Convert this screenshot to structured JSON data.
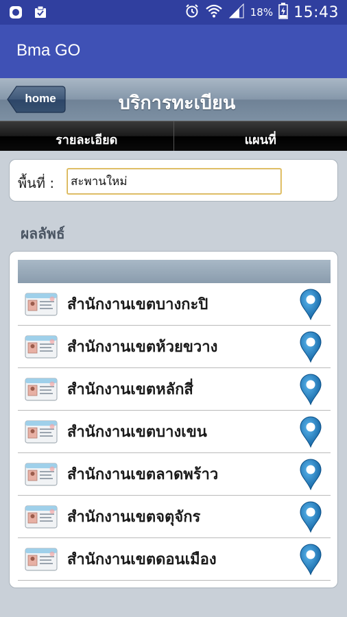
{
  "status_bar": {
    "battery_percent": "18%",
    "time": "15:43"
  },
  "app_bar": {
    "title": "Bma GO"
  },
  "page_header": {
    "home_label": "home",
    "title": "บริการทะเบียน"
  },
  "tabs": [
    {
      "label": "รายละเอียด"
    },
    {
      "label": "แผนที่"
    }
  ],
  "area": {
    "label": "พื้นที่ :",
    "value": "สะพานใหม่"
  },
  "results": {
    "heading": "ผลลัพธ์",
    "items": [
      {
        "label": "สำนักงานเขตบางกะปิ"
      },
      {
        "label": "สำนักงานเขตห้วยขวาง"
      },
      {
        "label": "สำนักงานเขตหลักสี่"
      },
      {
        "label": "สำนักงานเขตบางเขน"
      },
      {
        "label": "สำนักงานเขตลาดพร้าว"
      },
      {
        "label": "สำนักงานเขตจตุจักร"
      },
      {
        "label": "สำนักงานเขตดอนเมือง"
      }
    ]
  },
  "colors": {
    "status_bar": "#303f9f",
    "app_bar": "#3f51b5",
    "pin": "#1e7fc4"
  },
  "icons": [
    "app-circle-icon",
    "clipboard-check-icon",
    "alarm-icon",
    "wifi-icon",
    "signal-icon",
    "battery-icon",
    "id-card-icon",
    "map-pin-icon"
  ]
}
